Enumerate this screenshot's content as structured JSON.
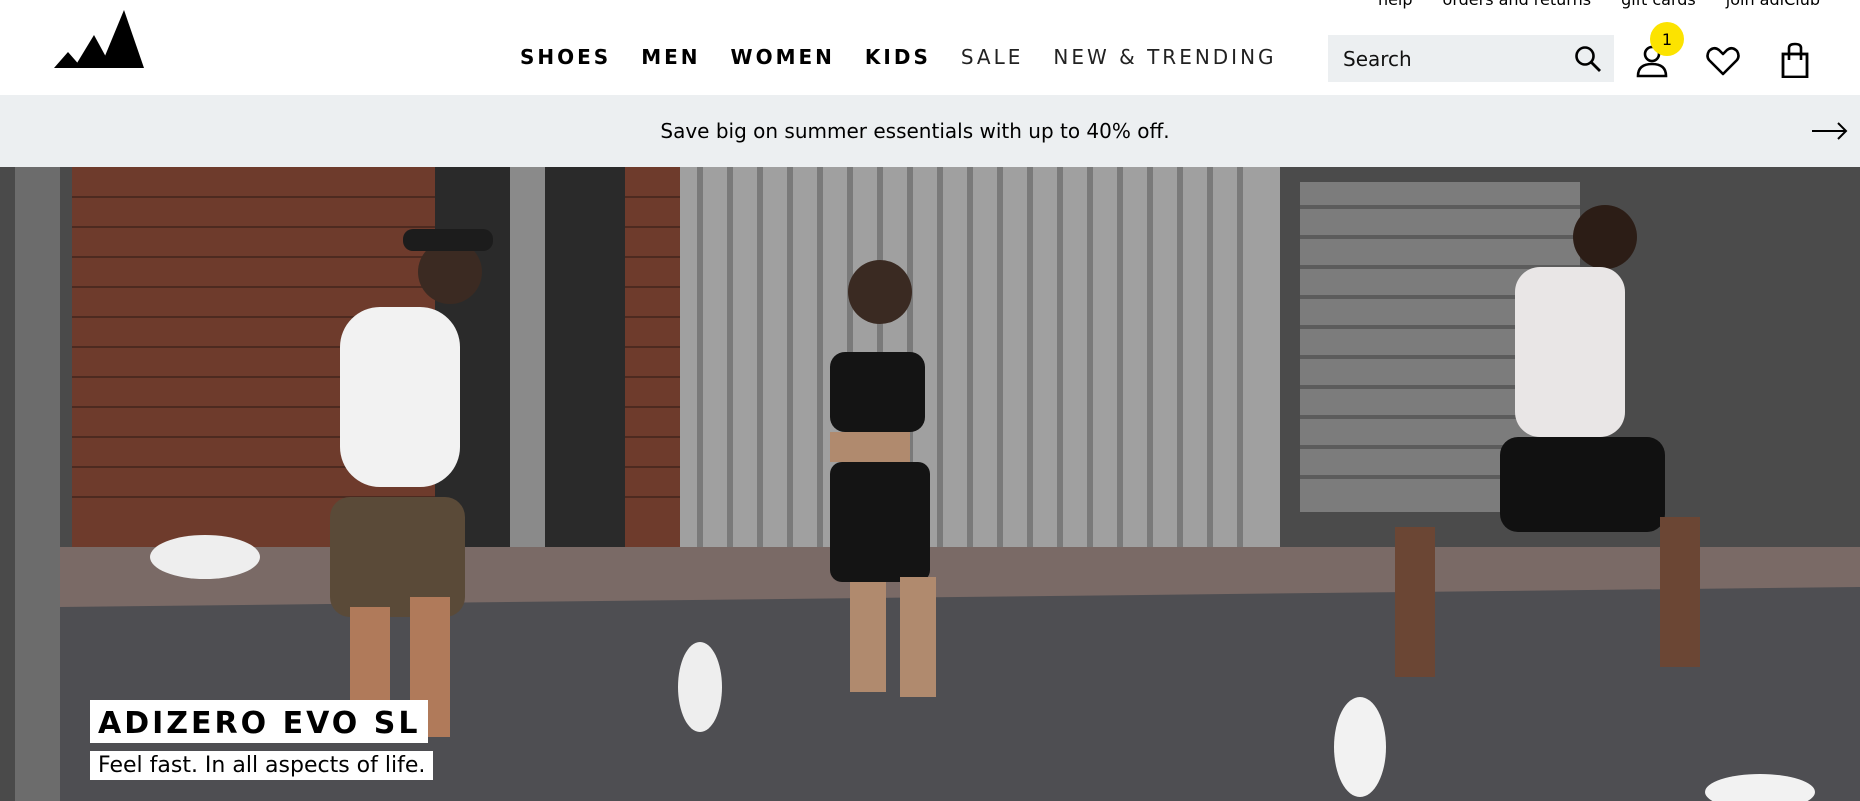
{
  "brand": {
    "logo": "adidas-performance-logo"
  },
  "utility_links": [
    "help",
    "orders and returns",
    "gift cards",
    "join adiClub"
  ],
  "nav": {
    "items": [
      {
        "label": "SHOES",
        "style": "bold"
      },
      {
        "label": "MEN",
        "style": "bold"
      },
      {
        "label": "WOMEN",
        "style": "bold"
      },
      {
        "label": "KIDS",
        "style": "bold"
      },
      {
        "label": "SALE",
        "style": "light"
      },
      {
        "label": "NEW & TRENDING",
        "style": "light"
      }
    ]
  },
  "search": {
    "placeholder": "Search",
    "icon": "search-icon"
  },
  "header_icons": {
    "account": "user-icon",
    "account_badge": "1",
    "wishlist": "heart-icon",
    "bag": "shopping-bag-icon"
  },
  "promo": {
    "text": "Save big on summer essentials with up to 40% off.",
    "icon": "arrow-right-icon"
  },
  "hero": {
    "title": "ADIZERO EVO SL",
    "subtitle": "Feel fast. In all aspects of life."
  },
  "colors": {
    "badge": "#fce300",
    "promo_bg": "#eceff1",
    "search_bg": "#eceff1"
  }
}
